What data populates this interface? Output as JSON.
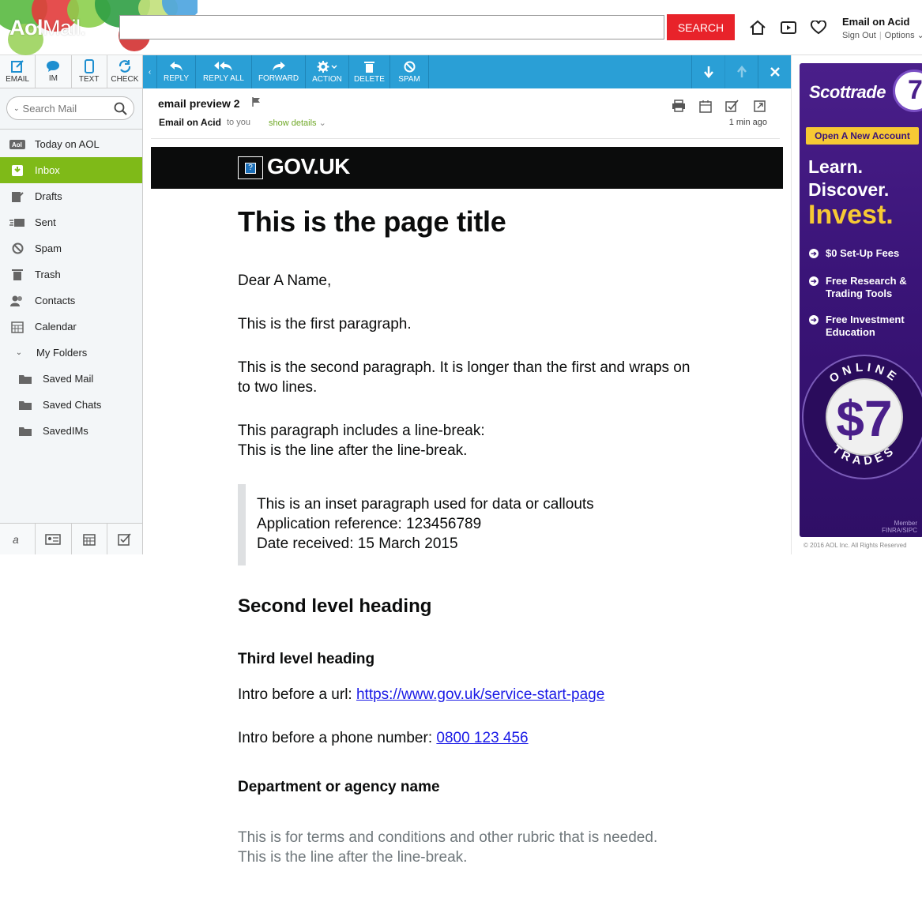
{
  "header": {
    "logo_aol": "Aol",
    "logo_mail": "Mail.",
    "search_placeholder": "",
    "search_button": "SEARCH",
    "user_name": "Email on Acid",
    "sign_out": "Sign Out",
    "options": "Options"
  },
  "sidebar": {
    "compose": [
      {
        "label": "EMAIL",
        "icon": "compose-icon"
      },
      {
        "label": "IM",
        "icon": "chat-bubble-icon"
      },
      {
        "label": "TEXT",
        "icon": "phone-icon"
      },
      {
        "label": "CHECK",
        "icon": "refresh-icon"
      }
    ],
    "search_placeholder": "Search Mail",
    "nav": [
      {
        "label": "Today on AOL",
        "icon": "aol-icon"
      },
      {
        "label": "Inbox",
        "icon": "inbox-icon",
        "active": true
      },
      {
        "label": "Drafts",
        "icon": "drafts-icon"
      },
      {
        "label": "Sent",
        "icon": "sent-icon"
      },
      {
        "label": "Spam",
        "icon": "spam-icon"
      },
      {
        "label": "Trash",
        "icon": "trash-icon"
      },
      {
        "label": "Contacts",
        "icon": "contacts-icon"
      },
      {
        "label": "Calendar",
        "icon": "calendar-icon"
      },
      {
        "label": "My Folders",
        "icon": "chevron-down-icon"
      },
      {
        "label": "Saved Mail",
        "icon": "folder-icon"
      },
      {
        "label": "Saved Chats",
        "icon": "folder-icon"
      },
      {
        "label": "SavedIMs",
        "icon": "folder-icon"
      }
    ]
  },
  "toolbar": {
    "reply": "REPLY",
    "reply_all": "REPLY ALL",
    "forward": "FORWARD",
    "action": "ACTION",
    "delete": "DELETE",
    "spam": "SPAM"
  },
  "message": {
    "subject": "email preview 2",
    "from": "Email on Acid",
    "to": "to you",
    "show_details": "show details",
    "time_ago": "1 min ago"
  },
  "email": {
    "gov_brand": "GOV.UK",
    "title": "This is the page title",
    "greeting": "Dear A Name,",
    "para1": "This is the first paragraph.",
    "para2_line1": "This is the second paragraph. It is longer than the first and wraps on",
    "para2_line2": "to two lines.",
    "para3_line1": "This paragraph includes a line-break:",
    "para3_line2": "This is the line after the line-break.",
    "inset_line1": "This is an inset paragraph used for data or callouts",
    "inset_line2": "Application reference: 123456789",
    "inset_line3": "Date received: 15 March 2015",
    "h2": "Second level heading",
    "h3": "Third level heading",
    "url_intro": "Intro before a url: ",
    "url": "https://www.gov.uk/service-start-page",
    "phone_intro": "Intro before a phone number: ",
    "phone": "0800 123 456",
    "department": "Department or agency name",
    "terms_line1": "This is for terms and conditions and other rubric that is needed.",
    "terms_line2": "This is the line after the line-break."
  },
  "ad": {
    "brand": "Scottrade",
    "cta": "Open A New Account",
    "learn": "Learn.",
    "discover": "Discover.",
    "invest": "Invest.",
    "features": [
      "$0 Set-Up Fees",
      "Free Research & Trading Tools",
      "Free Investment Education"
    ],
    "seal_top": "ONLINE",
    "seal_price": "$7",
    "seal_bottom": "TRADES",
    "member_line1": "Member",
    "member_line2": "FINRA/SIPC",
    "copyright": "© 2016 AOL Inc. All Rights Reserved"
  },
  "colors": {
    "toolbar_blue": "#2a9fd6",
    "inbox_green": "#7fba18",
    "search_red": "#e8232a",
    "gov_black": "#0b0c0c",
    "ad_purple": "#3a1478",
    "ad_gold": "#f7c934"
  }
}
